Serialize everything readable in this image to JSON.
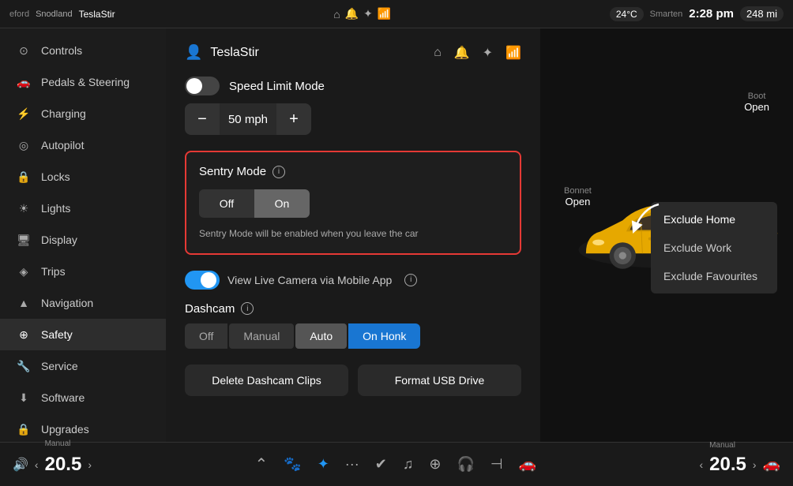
{
  "topbar": {
    "map_label": "eford",
    "location": "Snodland",
    "user": "TeslaStir",
    "temp": "24°C",
    "status_label": "Smarten",
    "time": "2:28 pm",
    "mileage": "248 mi",
    "icons": [
      "home",
      "bell",
      "bluetooth",
      "wifi"
    ]
  },
  "sidebar": {
    "items": [
      {
        "id": "controls",
        "label": "Controls",
        "icon": "⊙"
      },
      {
        "id": "pedals",
        "label": "Pedals & Steering",
        "icon": "🚗"
      },
      {
        "id": "charging",
        "label": "Charging",
        "icon": "⚡"
      },
      {
        "id": "autopilot",
        "label": "Autopilot",
        "icon": "◎"
      },
      {
        "id": "locks",
        "label": "Locks",
        "icon": "🔒"
      },
      {
        "id": "lights",
        "label": "Lights",
        "icon": "☀"
      },
      {
        "id": "display",
        "label": "Display",
        "icon": "🖥"
      },
      {
        "id": "trips",
        "label": "Trips",
        "icon": "⛽"
      },
      {
        "id": "navigation",
        "label": "Navigation",
        "icon": "▲"
      },
      {
        "id": "safety",
        "label": "Safety",
        "icon": "⊕",
        "active": true
      },
      {
        "id": "service",
        "label": "Service",
        "icon": "🔧"
      },
      {
        "id": "software",
        "label": "Software",
        "icon": "⬇"
      },
      {
        "id": "upgrades",
        "label": "Upgrades",
        "icon": "🔒"
      }
    ]
  },
  "settings": {
    "user_name": "TeslaStir",
    "speed_limit": {
      "label": "Speed Limit Mode",
      "value": "50 mph",
      "enabled": false
    },
    "sentry": {
      "label": "Sentry Mode",
      "state": "on",
      "description": "Sentry Mode will be enabled when you leave the car",
      "off_label": "Off",
      "on_label": "On"
    },
    "dropdown": {
      "items": [
        {
          "label": "Exclude Home",
          "selected": true
        },
        {
          "label": "Exclude Work"
        },
        {
          "label": "Exclude Favourites"
        }
      ]
    },
    "live_camera": {
      "label": "View Live Camera via Mobile App",
      "enabled": true
    },
    "dashcam": {
      "label": "Dashcam",
      "options": [
        "Off",
        "Manual",
        "Auto",
        "On Honk"
      ],
      "active": "Auto",
      "active_honk": true
    },
    "buttons": {
      "delete_clips": "Delete Dashcam Clips",
      "format_usb": "Format USB Drive"
    }
  },
  "car": {
    "boot_label": "Boot",
    "boot_value": "Open",
    "bonnet_label": "Bonnet",
    "bonnet_value": "Open",
    "color": "#e6a800"
  },
  "bottombar": {
    "left_temp_label": "Manual",
    "left_temp": "20.5",
    "right_temp_label": "Manual",
    "right_temp": "20.5",
    "icons": [
      "paw",
      "bluetooth",
      "more",
      "check",
      "spotify",
      "shield",
      "headphone",
      "seat",
      "car"
    ]
  }
}
